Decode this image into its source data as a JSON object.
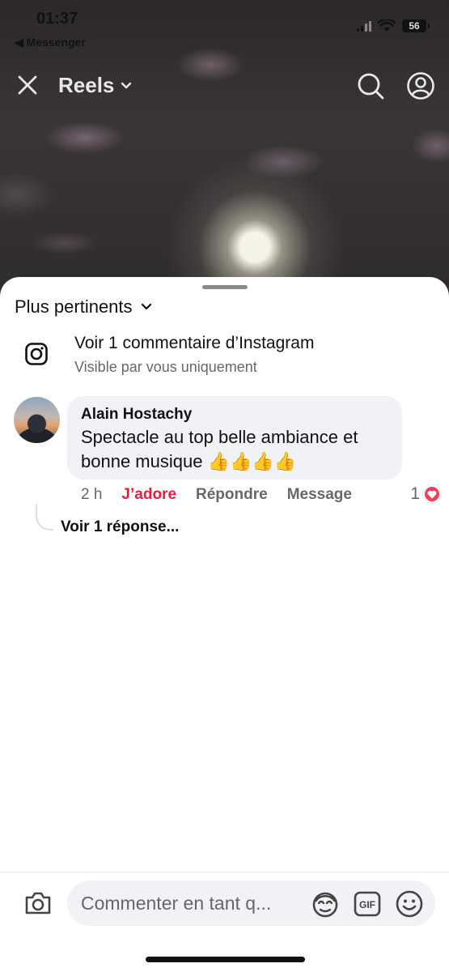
{
  "status_bar": {
    "time": "01:37",
    "back_label": "◀ Messenger",
    "battery": "56"
  },
  "header": {
    "title": "Reels",
    "icons": [
      "close-icon",
      "chevron-down-icon",
      "search-icon",
      "profile-icon"
    ]
  },
  "comments": {
    "sort_label": "Plus pertinents",
    "instagram": {
      "title": "Voir 1 commentaire d’Instagram",
      "subtitle": "Visible par vous uniquement"
    },
    "items": [
      {
        "author": "Alain Hostachy",
        "text": "Spectacle au top belle ambiance et bonne musique 👍👍👍👍",
        "time": "2 h",
        "like_label": "J’adore",
        "reply_label": "Répondre",
        "message_label": "Message",
        "reaction_count": "1",
        "reaction_type": "love",
        "replies_label": "Voir 1 réponse..."
      }
    ]
  },
  "composer": {
    "placeholder": "Commenter en tant q..."
  },
  "colors": {
    "like_active": "#e41e3f",
    "reaction_love": "#f33e58",
    "secondary_text": "#65676b",
    "bubble_bg": "#f0f2f5"
  }
}
